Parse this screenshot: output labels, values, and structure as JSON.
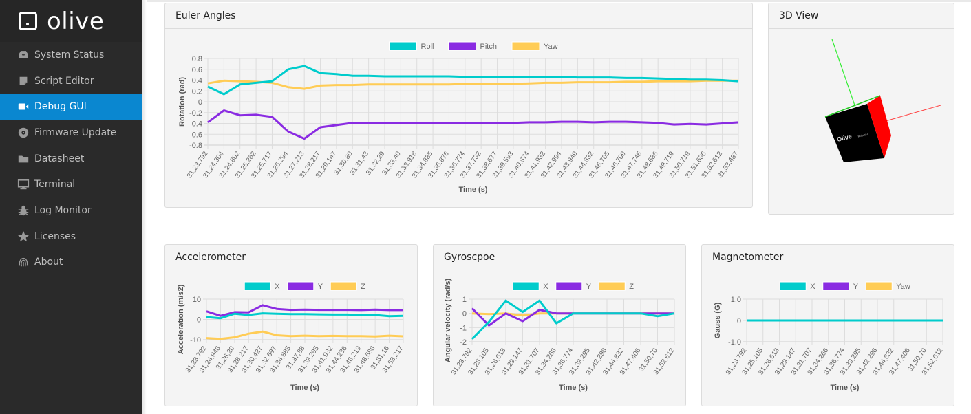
{
  "app": {
    "brand": "olive"
  },
  "sidebar": {
    "items": [
      {
        "label": "System Status",
        "icon": "inbox-icon",
        "active": false
      },
      {
        "label": "Script Editor",
        "icon": "note-icon",
        "active": false
      },
      {
        "label": "Debug GUI",
        "icon": "video-camera-icon",
        "active": true
      },
      {
        "label": "Firmware Update",
        "icon": "disc-icon",
        "active": false
      },
      {
        "label": "Datasheet",
        "icon": "folder-icon",
        "active": false
      },
      {
        "label": "Terminal",
        "icon": "monitor-icon",
        "active": false
      },
      {
        "label": "Log Monitor",
        "icon": "bug-icon",
        "active": false
      },
      {
        "label": "Licenses",
        "icon": "star-icon",
        "active": false
      },
      {
        "label": "About",
        "icon": "fingerprint-icon",
        "active": false
      }
    ]
  },
  "colors": {
    "accent": "#0a87d0",
    "series1": "#00cccc",
    "series2": "#8a2be2",
    "series3": "#ffcc55"
  },
  "panels": {
    "euler": {
      "title": "Euler Angles"
    },
    "view3d": {
      "title": "3D View",
      "cube_logo": "Olive",
      "cube_logo_sub": "Robotics"
    },
    "accel": {
      "title": "Accelerometer"
    },
    "gyro": {
      "title": "Gyroscpoe"
    },
    "mag": {
      "title": "Magnetometer"
    }
  },
  "chart_data": [
    {
      "id": "euler",
      "type": "line",
      "title": "Euler Angles",
      "xlabel": "Time (s)",
      "ylabel": "Rotation (rad)",
      "ylim": [
        -0.8,
        0.8
      ],
      "yticks": [
        "0.8",
        "0.6",
        "0.4",
        "0.2",
        "0",
        "-0.2",
        "-0.4",
        "-0.6",
        "-0.8"
      ],
      "ytick_values": [
        0.8,
        0.6,
        0.4,
        0.2,
        0,
        -0.2,
        -0.4,
        -0.6,
        -0.8
      ],
      "grid": true,
      "legend": "top-center",
      "x": [
        "31,23,792",
        "31,24,304",
        "31,24,802",
        "31,25,262",
        "31,25,717",
        "31,26,294",
        "31,27,213",
        "31,28,217",
        "31,29,147",
        "31,30,80",
        "31,31,43",
        "31,32,29",
        "31,33,40",
        "31,33,918",
        "31,34,885",
        "31,35,876",
        "31,36,774",
        "31,37,732",
        "31,38,677",
        "31,39,593",
        "31,40,874",
        "31,41,932",
        "31,42,994",
        "31,43,949",
        "31,44,832",
        "31,45,705",
        "31,46,709",
        "31,47,745",
        "31,48,686",
        "31,49,719",
        "31,50,719",
        "31,51,685",
        "31,52,612",
        "31,53,487"
      ],
      "series": [
        {
          "name": "Roll",
          "color": "#00cccc",
          "values": [
            0.28,
            0.14,
            0.32,
            0.35,
            0.38,
            0.6,
            0.66,
            0.53,
            0.51,
            0.48,
            0.48,
            0.47,
            0.47,
            0.47,
            0.47,
            0.47,
            0.46,
            0.46,
            0.46,
            0.46,
            0.46,
            0.46,
            0.46,
            0.45,
            0.45,
            0.45,
            0.44,
            0.44,
            0.43,
            0.42,
            0.41,
            0.41,
            0.4,
            0.38
          ]
        },
        {
          "name": "Pitch",
          "color": "#8a2be2",
          "values": [
            -0.38,
            -0.16,
            -0.25,
            -0.24,
            -0.28,
            -0.55,
            -0.68,
            -0.47,
            -0.43,
            -0.39,
            -0.39,
            -0.39,
            -0.4,
            -0.4,
            -0.4,
            -0.4,
            -0.39,
            -0.39,
            -0.39,
            -0.39,
            -0.38,
            -0.38,
            -0.37,
            -0.37,
            -0.38,
            -0.37,
            -0.37,
            -0.38,
            -0.39,
            -0.42,
            -0.41,
            -0.42,
            -0.4,
            -0.38
          ]
        },
        {
          "name": "Yaw",
          "color": "#ffcc55",
          "values": [
            0.34,
            0.39,
            0.38,
            0.37,
            0.35,
            0.27,
            0.24,
            0.3,
            0.31,
            0.31,
            0.32,
            0.32,
            0.32,
            0.32,
            0.32,
            0.32,
            0.33,
            0.33,
            0.33,
            0.33,
            0.34,
            0.35,
            0.35,
            0.36,
            0.36,
            0.36,
            0.37,
            0.37,
            0.38,
            0.38,
            0.38,
            0.39,
            0.39,
            0.39
          ]
        }
      ]
    },
    {
      "id": "accel",
      "type": "line",
      "title": "Accelerometer",
      "xlabel": "Time (s)",
      "ylabel": "Acceleration (m/s2)",
      "ylim": [
        -10,
        10
      ],
      "yticks": [
        "10",
        "0",
        "-10"
      ],
      "ytick_values": [
        10,
        0,
        -10
      ],
      "grid": true,
      "legend": "top-center",
      "x": [
        "31,23,792",
        "31,24,946",
        "31,26,20",
        "31,28,217",
        "31,30,427",
        "31,32,697",
        "31,34,885",
        "31,37,88",
        "31,39,295",
        "31,41,932",
        "31,44,236",
        "31,46,219",
        "31,48,686",
        "31,51,16",
        "31,53,217"
      ],
      "series": [
        {
          "name": "X",
          "color": "#00cccc",
          "values": [
            1.2,
            0.6,
            2.8,
            2.2,
            3.0,
            2.8,
            2.6,
            2.6,
            2.5,
            2.4,
            2.4,
            2.3,
            2.2,
            1.6,
            1.8
          ]
        },
        {
          "name": "Y",
          "color": "#8a2be2",
          "values": [
            4.0,
            1.8,
            3.6,
            3.5,
            7.0,
            5.2,
            4.7,
            4.8,
            4.7,
            4.7,
            4.7,
            4.6,
            4.8,
            4.6,
            4.6
          ]
        },
        {
          "name": "Z",
          "color": "#ffcc55",
          "values": [
            -9.2,
            -9.6,
            -8.8,
            -7.0,
            -6.0,
            -7.8,
            -8.2,
            -8.0,
            -8.2,
            -8.1,
            -8.2,
            -8.2,
            -8.4,
            -8.0,
            -8.3
          ]
        }
      ]
    },
    {
      "id": "gyro",
      "type": "line",
      "title": "Gyroscpoe",
      "xlabel": "Time (s)",
      "ylabel": "Angular velocity (rad/s)",
      "ylim": [
        -2,
        1
      ],
      "yticks": [
        "1",
        "0",
        "-1",
        "-2"
      ],
      "ytick_values": [
        1,
        0,
        -1,
        -2
      ],
      "grid": true,
      "legend": "top-center",
      "x": [
        "31,23,792",
        "31,25,105",
        "31,26,613",
        "31,29,147",
        "31,31,707",
        "31,34,266",
        "31,36,774",
        "31,39,295",
        "31,42,296",
        "31,44,832",
        "31,47,406",
        "31,50,70",
        "31,52,612"
      ],
      "series": [
        {
          "name": "X",
          "color": "#00cccc",
          "values": [
            -1.8,
            -0.6,
            0.9,
            0.1,
            0.9,
            -0.7,
            0.0,
            0.0,
            0.0,
            0.0,
            0.0,
            -0.2,
            0.0
          ]
        },
        {
          "name": "Y",
          "color": "#8a2be2",
          "values": [
            0.35,
            -0.85,
            0.0,
            -0.55,
            0.25,
            0.0,
            0.0,
            0.0,
            0.0,
            0.0,
            0.0,
            0.0,
            0.0
          ]
        },
        {
          "name": "Z",
          "color": "#ffcc55",
          "values": [
            0.0,
            -0.05,
            0.0,
            -0.15,
            0.0,
            0.0,
            0.0,
            0.0,
            0.0,
            0.0,
            0.0,
            0.0,
            0.0
          ]
        }
      ]
    },
    {
      "id": "mag",
      "type": "line",
      "title": "Magnetometer",
      "xlabel": "Time (s)",
      "ylabel": "Gauss (G)",
      "ylim": [
        -1.0,
        1.0
      ],
      "yticks": [
        "1.0",
        "0",
        "-1.0"
      ],
      "ytick_values": [
        1.0,
        0,
        -1.0
      ],
      "grid": true,
      "legend": "top-center",
      "x": [
        "31,23,792",
        "31,25,105",
        "31,26,613",
        "31,29,147",
        "31,31,707",
        "31,34,266",
        "31,36,774",
        "31,39,295",
        "31,42,296",
        "31,44,832",
        "31,47,406",
        "31,50,70",
        "31,52,612"
      ],
      "series": [
        {
          "name": "X",
          "color": "#00cccc",
          "values": [
            0,
            0,
            0,
            0,
            0,
            0,
            0,
            0,
            0,
            0,
            0,
            0,
            0
          ]
        },
        {
          "name": "Y",
          "color": "#8a2be2",
          "values": [
            0,
            0,
            0,
            0,
            0,
            0,
            0,
            0,
            0,
            0,
            0,
            0,
            0
          ]
        },
        {
          "name": "Yaw",
          "color": "#ffcc55",
          "values": [
            0,
            0,
            0,
            0,
            0,
            0,
            0,
            0,
            0,
            0,
            0,
            0,
            0
          ]
        }
      ]
    }
  ]
}
